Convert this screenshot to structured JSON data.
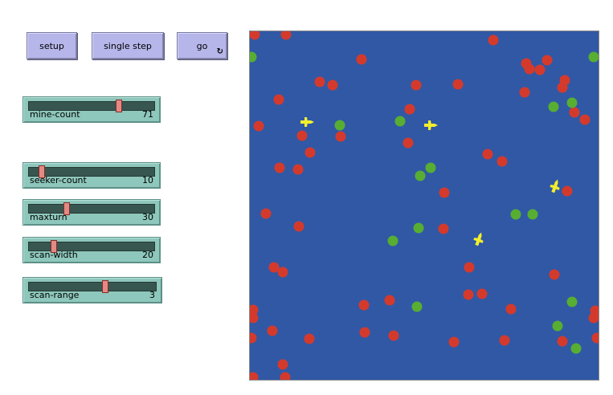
{
  "buttons": {
    "setup": "setup",
    "single_step": "single step",
    "go": "go",
    "go_forever_glyph": "↻"
  },
  "sliders": [
    {
      "name": "mine-count",
      "value": "71",
      "fraction": 0.72
    },
    {
      "name": "seeker-count",
      "value": "10",
      "fraction": 0.1
    },
    {
      "name": "maxturn",
      "value": "30",
      "fraction": 0.3
    },
    {
      "name": "scan-width",
      "value": "20",
      "fraction": 0.2
    },
    {
      "name": "scan-range",
      "value": "3",
      "fraction": 0.6
    }
  ],
  "colors": {
    "world_background": "#3158a5",
    "mine": "#d43a2c",
    "cleared": "#57ae32",
    "seeker": "#f2ef2c",
    "button": "#b6b6ea",
    "slider": "#8ec7bc"
  }
}
